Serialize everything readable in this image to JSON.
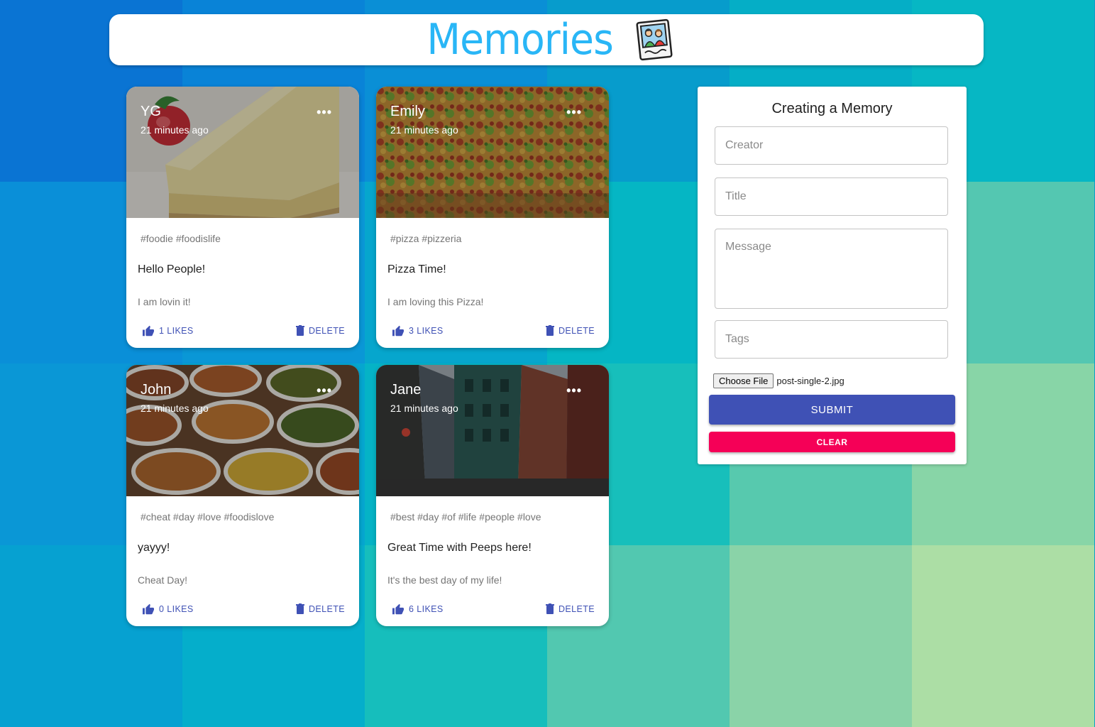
{
  "app": {
    "title": "Memories",
    "logo_icon": "polaroid-photo-icon",
    "accent": "#29b6f6"
  },
  "background": {
    "tiles": [
      "#0a74d3",
      "#0983d7",
      "#0a8fd6",
      "#079ccc",
      "#05aec6",
      "#06b7c4",
      "#0a8fd8",
      "#0a97d6",
      "#06a6cd",
      "#05b6c4",
      "#3cc5b8",
      "#54c7b1",
      "#0a97d6",
      "#05a6cf",
      "#05b3c6",
      "#17bfbb",
      "#57c9ae",
      "#88d5a7",
      "#06a1d1",
      "#05aecb",
      "#16bebc",
      "#52c8b0",
      "#8ad3a8",
      "#acdea5"
    ]
  },
  "posts": [
    {
      "creator": "YG",
      "time": "21 minutes ago",
      "tags": "#foodie #foodislife",
      "title": "Hello People!",
      "message": "I am lovin it!",
      "likes": "1 LIKES",
      "delete": "DELETE",
      "image": "cheesecake"
    },
    {
      "creator": "Emily",
      "time": "21 minutes ago",
      "tags": "#pizza #pizzeria",
      "title": "Pizza Time!",
      "message": "I am loving this Pizza!",
      "likes": "3 LIKES",
      "delete": "DELETE",
      "image": "pizza"
    },
    {
      "creator": "John",
      "time": "21 minutes ago",
      "tags": "#cheat #day #love #foodislove",
      "title": "yayyy!",
      "message": "Cheat Day!",
      "likes": "0 LIKES",
      "delete": "DELETE",
      "image": "food-bowls"
    },
    {
      "creator": "Jane",
      "time": "21 minutes ago",
      "tags": "#best #day #of #life #people #love",
      "title": "Great Time with Peeps here!",
      "message": "It's the best day of my life!",
      "likes": "6 LIKES",
      "delete": "DELETE",
      "image": "street-buildings"
    }
  ],
  "form": {
    "title": "Creating a Memory",
    "creator_placeholder": "Creator",
    "title_placeholder": "Title",
    "message_placeholder": "Message",
    "tags_placeholder": "Tags",
    "choose_file_label": "Choose File",
    "file_name": "post-single-2.jpg",
    "submit_label": "SUBMIT",
    "clear_label": "CLEAR",
    "submit_color": "#3f51b5",
    "clear_color": "#f50057"
  }
}
